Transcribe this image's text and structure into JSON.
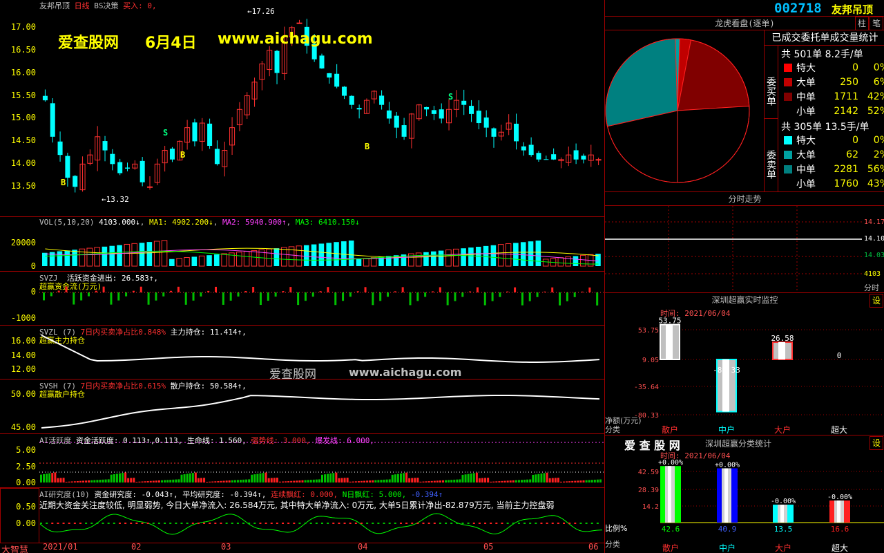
{
  "header": {
    "stock_name": "友邦吊顶",
    "period_label": "日线",
    "strategy_label": "BS决策",
    "buy_label": "买入: 0,",
    "stock_code": "002718",
    "stock_title": "友邦吊顶"
  },
  "watermark": {
    "brand": "爱查股网",
    "date": "6月4日",
    "url": "www.aichagu.com",
    "mid_brand": "爱查股网",
    "mid_url": "www.aichagu.com"
  },
  "price_axis": [
    "17.00",
    "16.50",
    "16.00",
    "15.50",
    "15.00",
    "14.50",
    "14.00",
    "13.50"
  ],
  "price_annotations": {
    "high": "17.26",
    "low": "13.32"
  },
  "vol": {
    "title": "VOL(5,10,20)",
    "v": "4103.000↓",
    "ma1": "MA1: 4902.200↓",
    "ma2": "MA2: 5940.900↑",
    "ma3": "MA3: 6410.150↓",
    "ticks": [
      "20000",
      "0"
    ]
  },
  "svzj": {
    "title": "SVZJ",
    "label": "活跃资金进出: 26.583↑,",
    "sub": "超赢资金流(万元)",
    "ticks": [
      "0",
      "-1000"
    ]
  },
  "svzl": {
    "title": "SVZL (7)",
    "hint": "7日内买卖净占比0.848%",
    "label": "主力持仓: 11.414↑,",
    "sub": "超赢主力持仓",
    "ticks": [
      "16.00",
      "14.00",
      "12.00"
    ]
  },
  "svsh": {
    "title": "SVSH (7)",
    "hint": "7日内买卖净占比0.615%",
    "label": "散户持仓: 50.584↑,",
    "sub": "超赢散户持仓",
    "ticks": [
      "50.00",
      "45.00"
    ]
  },
  "ai1": {
    "title": "AI活跃度",
    "a": "资金活跃度: 0.113↑,0.113,",
    "b": "生命线: 1.560,",
    "c": "强势线: 3.000,",
    "d": "爆发线: 6.000,",
    "ticks": [
      "5.00",
      "2.50",
      "0.00"
    ]
  },
  "ai2": {
    "title": "AI研究度(10)",
    "a": "资金研究度: -0.043↑,",
    "b": "平均研究度: -0.394↑,",
    "c": "连续飘红: 0.000,",
    "d": "N日飘红: 5.000,",
    "e": "-0.394↑",
    "comment": "近期大资金关注度较低, 明显弱势, 今日大单净流入: 26.584万元, 其中特大单净流入: 0万元, 大单5日累计净出-82.879万元, 当前主力控盘弱",
    "ticks": [
      "0.50",
      "0.00"
    ]
  },
  "corner_label": "大智慧",
  "x_axis": [
    "2021/01",
    "02",
    "03",
    "04",
    "05",
    "06"
  ],
  "side": {
    "btn1": "柱",
    "btn2": "笔",
    "pie_title": "龙虎看盘(逐单)",
    "pie_subtitle": "已成交委托单成交量统计",
    "buy_total": "共 501单 8.2手/单",
    "sell_total": "共 305单 13.5手/单",
    "buy_label": "委买单",
    "sell_label": "委卖单",
    "buy_rows": [
      {
        "name": "特大",
        "val": "0",
        "pct": "0%",
        "color": "#ff0000"
      },
      {
        "name": "大单",
        "val": "250",
        "pct": "6%",
        "color": "#c00000"
      },
      {
        "name": "中单",
        "val": "1711",
        "pct": "42%",
        "color": "#800000"
      },
      {
        "name": "小单",
        "val": "2142",
        "pct": "52%",
        "color": "#000000"
      }
    ],
    "sell_rows": [
      {
        "name": "特大",
        "val": "0",
        "pct": "0%",
        "color": "#00ffff"
      },
      {
        "name": "大单",
        "val": "62",
        "pct": "2%",
        "color": "#00a0a0"
      },
      {
        "name": "中单",
        "val": "2281",
        "pct": "56%",
        "color": "#008080"
      },
      {
        "name": "小单",
        "val": "1760",
        "pct": "43%",
        "color": "#000000"
      }
    ],
    "intraday_title": "分时走势",
    "intraday_ticks": [
      "14.17",
      "14.10",
      "14.03"
    ],
    "intraday_vol": "4103",
    "intraday_unit": "分时",
    "mon_title": "深圳超赢实时监控",
    "mon_btn": "设",
    "mon_time": "时间: 2021/06/04",
    "mon_ticks": [
      "53.75",
      "9.05",
      "-35.64",
      "-80.33"
    ],
    "mon_unit": "净额(万元)",
    "mon_cat": "分类",
    "mon_vals": [
      "53.75",
      "-80.33",
      "26.58",
      "0"
    ],
    "cats": [
      "散户",
      "中户",
      "大户",
      "超大"
    ],
    "stat_brand": "爱 查 股 网",
    "stat_title": "深圳超赢分类统计",
    "stat_time": "时间: 2021/06/04",
    "stat_ticks": [
      "42.59",
      "28.39",
      "14.2"
    ],
    "stat_tops": [
      "+0.00%",
      "+0.00%",
      "-0.00%",
      "-0.00%"
    ],
    "stat_vals": [
      "42.6",
      "40.9",
      "13.5",
      "16.6"
    ],
    "stat_unit": "比例%",
    "stat_cat": "分类"
  },
  "chart_data": {
    "type": "candlestick",
    "x": [
      "2021/01",
      "02",
      "03",
      "04",
      "05",
      "06"
    ],
    "ylim": [
      13.2,
      17.3
    ],
    "close_series_approx": [
      15.4,
      14.6,
      14.2,
      13.7,
      13.5,
      14.0,
      14.2,
      14.6,
      14.3,
      14.0,
      13.8,
      13.9,
      14.0,
      13.6,
      13.5,
      14.0,
      14.3,
      14.1,
      14.5,
      14.8,
      14.5,
      14.9,
      14.4,
      14.0,
      14.3,
      14.8,
      15.2,
      15.5,
      15.8,
      16.2,
      16.5,
      16.0,
      16.8,
      17.0,
      17.1,
      16.6,
      16.3,
      16.1,
      15.9,
      15.7,
      15.5,
      15.3,
      15.2,
      15.4,
      15.6,
      15.3,
      15.0,
      14.8,
      14.6,
      15.1,
      15.3,
      15.2,
      15.1,
      15.0,
      15.2,
      15.4,
      15.3,
      15.1,
      14.9,
      14.8,
      14.6,
      14.7,
      14.9,
      14.5,
      14.3,
      14.2,
      14.1,
      14.1,
      14.1,
      14.1,
      14.2,
      14.1,
      14.1,
      14.2,
      14.1
    ],
    "pie_buy_pct": [
      0,
      6,
      42,
      52
    ],
    "pie_sell_pct": [
      0,
      2,
      56,
      43
    ],
    "monitor_values": [
      53.75,
      -80.33,
      26.58,
      0
    ],
    "stat_values": [
      42.6,
      40.9,
      13.5,
      16.6
    ]
  }
}
